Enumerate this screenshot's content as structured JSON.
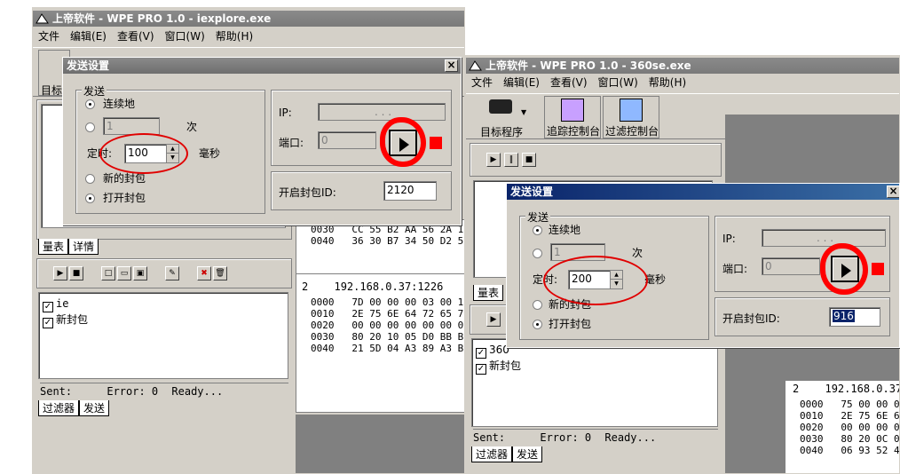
{
  "left_app": {
    "title": "上帝软件 - WPE PRO 1.0 - iexplore.exe",
    "menu": [
      "文件",
      "编辑(E)",
      "查看(V)",
      "窗口(W)",
      "帮助(H)"
    ],
    "toolbar_partial_label": "目标",
    "tabs_top": [
      "量表",
      "详情"
    ],
    "filter_list": [
      "ie",
      "新封包"
    ],
    "status": {
      "sent": "Sent:",
      "error": "Error: 0",
      "ready": "Ready..."
    },
    "tabs_bottom": [
      "过滤器",
      "发送"
    ],
    "hex_upper": [
      {
        "off": "0030",
        "bytes": "CC 55 B2 AA 56 2A 1"
      },
      {
        "off": "0040",
        "bytes": "36 30 B7 34 50 D2 5"
      }
    ],
    "packet_header": {
      "num": "2",
      "addr": "192.168.0.37:1226"
    },
    "hex_lower": [
      {
        "off": "0000",
        "bytes": "7D 00 00 00 03 00 1"
      },
      {
        "off": "0010",
        "bytes": "2E 75 6E 64 72 65 7"
      },
      {
        "off": "0020",
        "bytes": "00 00 00 00 00 00 0"
      },
      {
        "off": "0030",
        "bytes": "80 20 10 05 D0 BB B"
      },
      {
        "off": "0040",
        "bytes": "21 5D 04 A3 89 A3 B"
      }
    ]
  },
  "left_dialog": {
    "title": "发送设置",
    "group_label": "发送",
    "radio_continuous": "连续地",
    "count_value": "1",
    "count_unit": "次",
    "timer_label": "定时:",
    "timer_value": "100",
    "timer_unit": "毫秒",
    "radio_new_packet": "新的封包",
    "radio_open_packet": "打开封包",
    "ip_label": "IP:",
    "ip_value": ".   .   .",
    "port_label": "端口:",
    "port_value": "0",
    "open_id_label": "开启封包ID:",
    "open_id_value": "2120",
    "close_glyph": "×"
  },
  "right_app": {
    "title": "上帝软件 - WPE PRO 1.0 - 360se.exe",
    "menu": [
      "文件",
      "编辑(E)",
      "查看(V)",
      "窗口(W)",
      "帮助(H)"
    ],
    "toolbar": [
      "目标程序",
      "追踪控制台",
      "过滤控制台"
    ],
    "tabs_top_partial": "量表",
    "filter_list": [
      "360",
      "新封包"
    ],
    "status": {
      "sent": "Sent:",
      "error": "Error: 0",
      "ready": "Ready..."
    },
    "tabs_bottom": [
      "过滤器",
      "发送"
    ],
    "packet_header": {
      "num": "2",
      "addr": "192.168.0.37"
    },
    "hex_lower": [
      {
        "off": "0000",
        "bytes": "75 00 00 0"
      },
      {
        "off": "0010",
        "bytes": "2E 75 6E 6"
      },
      {
        "off": "0020",
        "bytes": "00 00 00 0"
      },
      {
        "off": "0030",
        "bytes": "80 20 0C 0"
      },
      {
        "off": "0040",
        "bytes": "06 93 52 4"
      }
    ]
  },
  "right_dialog": {
    "title": "发送设置",
    "group_label": "发送",
    "radio_continuous": "连续地",
    "count_value": "1",
    "count_unit": "次",
    "timer_label": "定时:",
    "timer_value": "200",
    "timer_unit": "毫秒",
    "radio_new_packet": "新的封包",
    "radio_open_packet": "打开封包",
    "ip_label": "IP:",
    "ip_value": ".   .   .",
    "port_label": "端口:",
    "port_value": "0",
    "open_id_label": "开启封包ID:",
    "open_id_value": "916",
    "close_glyph": "×"
  },
  "colors": {
    "active_title": "#0a246a",
    "inactive_title": "#808080",
    "stop": "#ff0000",
    "annotation": "#e00000"
  }
}
